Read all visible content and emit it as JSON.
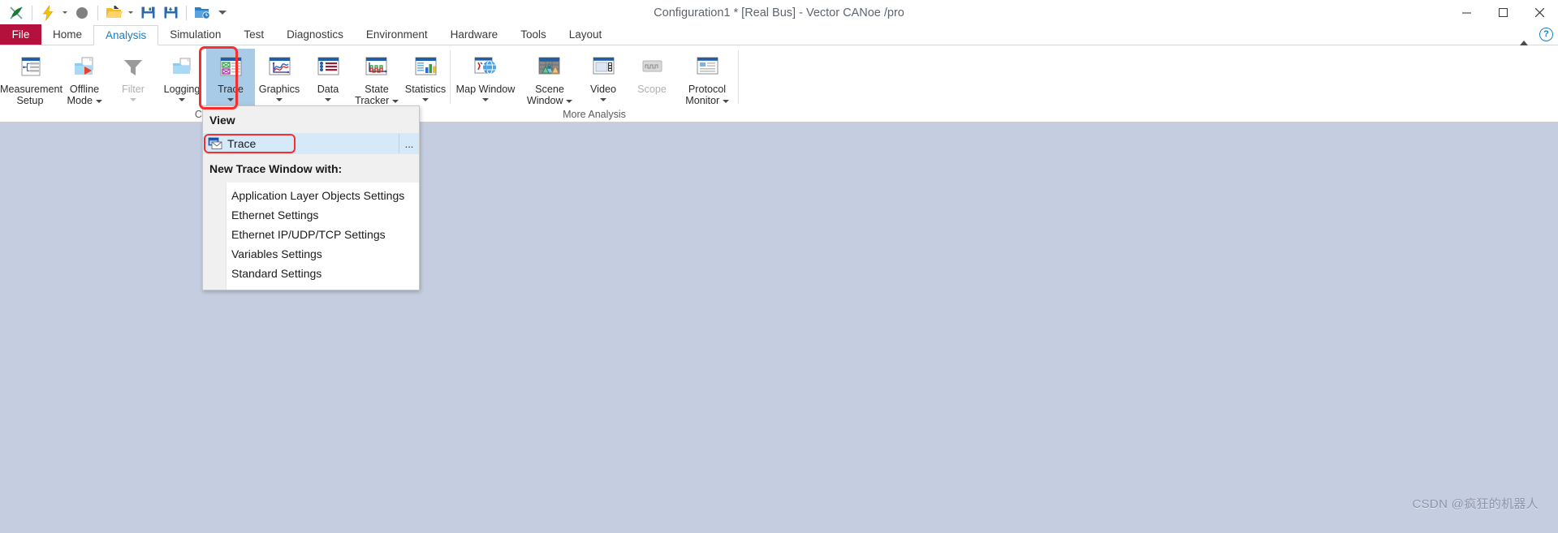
{
  "window": {
    "title": "Configuration1 * [Real Bus] - Vector CANoe /pro",
    "minimize": "—",
    "maximize": "▢",
    "close": "✕"
  },
  "quick_access": [
    {
      "name": "vector-logo-icon",
      "glyph": ""
    },
    {
      "name": "lightning-icon",
      "glyph": ""
    },
    {
      "name": "record-icon",
      "glyph": ""
    },
    {
      "name": "open-folder-icon",
      "glyph": ""
    },
    {
      "name": "save-icon",
      "glyph": ""
    },
    {
      "name": "save-as-icon",
      "glyph": ""
    },
    {
      "name": "folder-time-icon",
      "glyph": ""
    },
    {
      "name": "customize-qat-icon",
      "glyph": "▾"
    }
  ],
  "tabs": {
    "file_label": "File",
    "items": [
      {
        "label": "Home",
        "active": false
      },
      {
        "label": "Analysis",
        "active": true
      },
      {
        "label": "Simulation",
        "active": false
      },
      {
        "label": "Test",
        "active": false
      },
      {
        "label": "Diagnostics",
        "active": false
      },
      {
        "label": "Environment",
        "active": false
      },
      {
        "label": "Hardware",
        "active": false
      },
      {
        "label": "Tools",
        "active": false
      },
      {
        "label": "Layout",
        "active": false
      }
    ],
    "collapse_ribbon": "▲",
    "help": "?"
  },
  "ribbon": {
    "groups": [
      {
        "title": "Configuration",
        "items": [
          {
            "label": "Measurement\nSetup",
            "label_line1": "Measurement",
            "label_line2": "Setup",
            "icon": "measurement-setup-icon",
            "has_split": false,
            "disabled": false,
            "selected": false
          },
          {
            "label": "Offline Mode",
            "label_line1": "Offline",
            "label_line2": "Mode",
            "icon": "offline-mode-icon",
            "has_split": true,
            "disabled": false,
            "selected": false
          },
          {
            "label": "Filter",
            "label_line1": "Filter",
            "label_line2": "",
            "icon": "filter-icon",
            "has_split": true,
            "disabled": true,
            "selected": false
          },
          {
            "label": "Logging",
            "label_line1": "Logging",
            "label_line2": "",
            "icon": "logging-icon",
            "has_split": true,
            "disabled": false,
            "selected": false
          },
          {
            "label": "Trace",
            "label_line1": "Trace",
            "label_line2": "",
            "icon": "trace-icon",
            "has_split": true,
            "disabled": false,
            "selected": true
          },
          {
            "label": "Graphics",
            "label_line1": "Graphics",
            "label_line2": "",
            "icon": "graphics-icon",
            "has_split": true,
            "disabled": false,
            "selected": false
          },
          {
            "label": "Data",
            "label_line1": "Data",
            "label_line2": "",
            "icon": "data-icon",
            "has_split": true,
            "disabled": false,
            "selected": false
          },
          {
            "label": "State Tracker",
            "label_line1": "State",
            "label_line2": "Tracker",
            "icon": "state-tracker-icon",
            "has_split": true,
            "disabled": false,
            "selected": false
          },
          {
            "label": "Statistics",
            "label_line1": "Statistics",
            "label_line2": "",
            "icon": "statistics-icon",
            "has_split": true,
            "disabled": false,
            "selected": false
          }
        ]
      },
      {
        "title": "More Analysis",
        "items": [
          {
            "label": "Map Window",
            "label_line1": "Map Window",
            "label_line2": "",
            "icon": "map-window-icon",
            "has_split": true,
            "disabled": false,
            "selected": false
          },
          {
            "label": "Scene Window",
            "label_line1": "Scene",
            "label_line2": "Window",
            "icon": "scene-window-icon",
            "has_split": true,
            "disabled": false,
            "selected": false
          },
          {
            "label": "Video",
            "label_line1": "Video",
            "label_line2": "",
            "icon": "video-icon",
            "has_split": true,
            "disabled": false,
            "selected": false
          },
          {
            "label": "Scope",
            "label_line1": "Scope",
            "label_line2": "",
            "icon": "scope-icon",
            "has_split": false,
            "disabled": true,
            "selected": false
          },
          {
            "label": "Protocol Monitor",
            "label_line1": "Protocol",
            "label_line2": "Monitor",
            "icon": "protocol-monitor-icon",
            "has_split": true,
            "disabled": false,
            "selected": false
          }
        ]
      }
    ]
  },
  "dropdown": {
    "view_header": "View",
    "view_item": {
      "label": "Trace",
      "icon": "trace-window-icon",
      "overflow": "..."
    },
    "section_header": "New Trace Window with:",
    "items": [
      {
        "label": "Application Layer Objects Settings"
      },
      {
        "label": "Ethernet Settings"
      },
      {
        "label": "Ethernet IP/UDP/TCP Settings"
      },
      {
        "label": "Variables Settings"
      },
      {
        "label": "Standard Settings"
      }
    ]
  },
  "watermark": "CSDN @疯狂的机器人",
  "colors": {
    "accent_blue": "#1a7ec4",
    "file_tab_red": "#b4123c",
    "highlight_red": "#fb2c2c",
    "selected_blue": "#a8cbe8",
    "workspace": "#c5cee0"
  }
}
